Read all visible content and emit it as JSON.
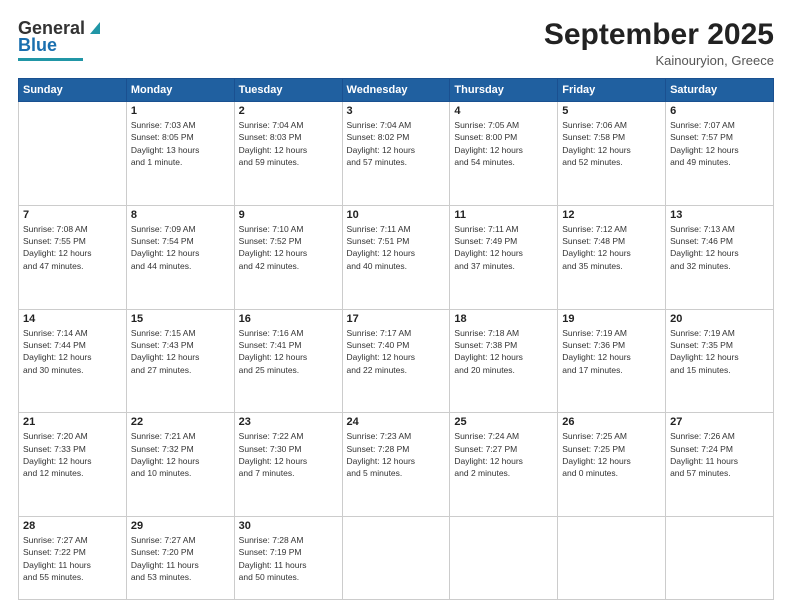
{
  "header": {
    "logo_line1": "General",
    "logo_line2": "Blue",
    "title": "September 2025",
    "subtitle": "Kainouryion, Greece"
  },
  "calendar": {
    "days_of_week": [
      "Sunday",
      "Monday",
      "Tuesday",
      "Wednesday",
      "Thursday",
      "Friday",
      "Saturday"
    ],
    "weeks": [
      [
        {
          "day": "",
          "info": ""
        },
        {
          "day": "1",
          "info": "Sunrise: 7:03 AM\nSunset: 8:05 PM\nDaylight: 13 hours\nand 1 minute."
        },
        {
          "day": "2",
          "info": "Sunrise: 7:04 AM\nSunset: 8:03 PM\nDaylight: 12 hours\nand 59 minutes."
        },
        {
          "day": "3",
          "info": "Sunrise: 7:04 AM\nSunset: 8:02 PM\nDaylight: 12 hours\nand 57 minutes."
        },
        {
          "day": "4",
          "info": "Sunrise: 7:05 AM\nSunset: 8:00 PM\nDaylight: 12 hours\nand 54 minutes."
        },
        {
          "day": "5",
          "info": "Sunrise: 7:06 AM\nSunset: 7:58 PM\nDaylight: 12 hours\nand 52 minutes."
        },
        {
          "day": "6",
          "info": "Sunrise: 7:07 AM\nSunset: 7:57 PM\nDaylight: 12 hours\nand 49 minutes."
        }
      ],
      [
        {
          "day": "7",
          "info": "Sunrise: 7:08 AM\nSunset: 7:55 PM\nDaylight: 12 hours\nand 47 minutes."
        },
        {
          "day": "8",
          "info": "Sunrise: 7:09 AM\nSunset: 7:54 PM\nDaylight: 12 hours\nand 44 minutes."
        },
        {
          "day": "9",
          "info": "Sunrise: 7:10 AM\nSunset: 7:52 PM\nDaylight: 12 hours\nand 42 minutes."
        },
        {
          "day": "10",
          "info": "Sunrise: 7:11 AM\nSunset: 7:51 PM\nDaylight: 12 hours\nand 40 minutes."
        },
        {
          "day": "11",
          "info": "Sunrise: 7:11 AM\nSunset: 7:49 PM\nDaylight: 12 hours\nand 37 minutes."
        },
        {
          "day": "12",
          "info": "Sunrise: 7:12 AM\nSunset: 7:48 PM\nDaylight: 12 hours\nand 35 minutes."
        },
        {
          "day": "13",
          "info": "Sunrise: 7:13 AM\nSunset: 7:46 PM\nDaylight: 12 hours\nand 32 minutes."
        }
      ],
      [
        {
          "day": "14",
          "info": "Sunrise: 7:14 AM\nSunset: 7:44 PM\nDaylight: 12 hours\nand 30 minutes."
        },
        {
          "day": "15",
          "info": "Sunrise: 7:15 AM\nSunset: 7:43 PM\nDaylight: 12 hours\nand 27 minutes."
        },
        {
          "day": "16",
          "info": "Sunrise: 7:16 AM\nSunset: 7:41 PM\nDaylight: 12 hours\nand 25 minutes."
        },
        {
          "day": "17",
          "info": "Sunrise: 7:17 AM\nSunset: 7:40 PM\nDaylight: 12 hours\nand 22 minutes."
        },
        {
          "day": "18",
          "info": "Sunrise: 7:18 AM\nSunset: 7:38 PM\nDaylight: 12 hours\nand 20 minutes."
        },
        {
          "day": "19",
          "info": "Sunrise: 7:19 AM\nSunset: 7:36 PM\nDaylight: 12 hours\nand 17 minutes."
        },
        {
          "day": "20",
          "info": "Sunrise: 7:19 AM\nSunset: 7:35 PM\nDaylight: 12 hours\nand 15 minutes."
        }
      ],
      [
        {
          "day": "21",
          "info": "Sunrise: 7:20 AM\nSunset: 7:33 PM\nDaylight: 12 hours\nand 12 minutes."
        },
        {
          "day": "22",
          "info": "Sunrise: 7:21 AM\nSunset: 7:32 PM\nDaylight: 12 hours\nand 10 minutes."
        },
        {
          "day": "23",
          "info": "Sunrise: 7:22 AM\nSunset: 7:30 PM\nDaylight: 12 hours\nand 7 minutes."
        },
        {
          "day": "24",
          "info": "Sunrise: 7:23 AM\nSunset: 7:28 PM\nDaylight: 12 hours\nand 5 minutes."
        },
        {
          "day": "25",
          "info": "Sunrise: 7:24 AM\nSunset: 7:27 PM\nDaylight: 12 hours\nand 2 minutes."
        },
        {
          "day": "26",
          "info": "Sunrise: 7:25 AM\nSunset: 7:25 PM\nDaylight: 12 hours\nand 0 minutes."
        },
        {
          "day": "27",
          "info": "Sunrise: 7:26 AM\nSunset: 7:24 PM\nDaylight: 11 hours\nand 57 minutes."
        }
      ],
      [
        {
          "day": "28",
          "info": "Sunrise: 7:27 AM\nSunset: 7:22 PM\nDaylight: 11 hours\nand 55 minutes."
        },
        {
          "day": "29",
          "info": "Sunrise: 7:27 AM\nSunset: 7:20 PM\nDaylight: 11 hours\nand 53 minutes."
        },
        {
          "day": "30",
          "info": "Sunrise: 7:28 AM\nSunset: 7:19 PM\nDaylight: 11 hours\nand 50 minutes."
        },
        {
          "day": "",
          "info": ""
        },
        {
          "day": "",
          "info": ""
        },
        {
          "day": "",
          "info": ""
        },
        {
          "day": "",
          "info": ""
        }
      ]
    ]
  }
}
